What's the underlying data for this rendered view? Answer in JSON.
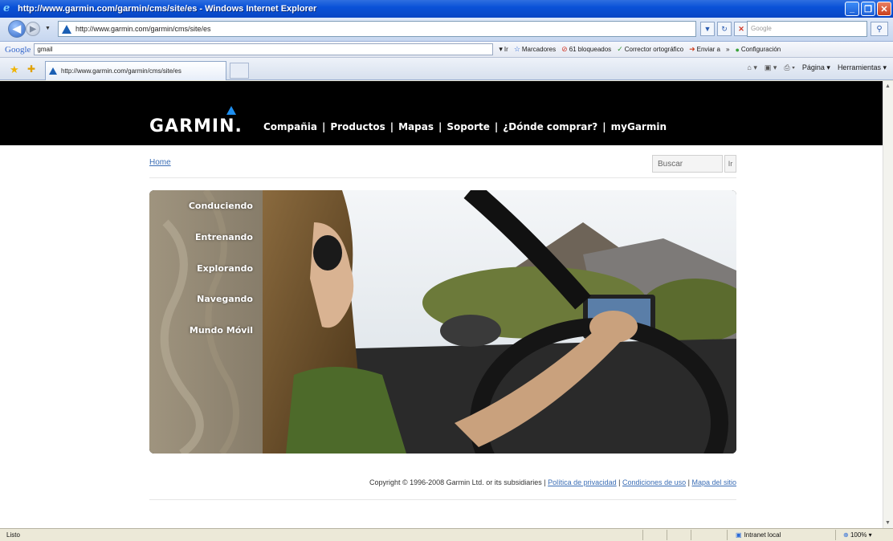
{
  "window": {
    "title": "http://www.garmin.com/garmin/cms/site/es - Windows Internet Explorer"
  },
  "address_bar": {
    "url": "http://www.garmin.com/garmin/cms/site/es",
    "search_placeholder": "Google"
  },
  "google_toolbar": {
    "logo": "Google",
    "search_value": "gmail",
    "go_label": "Ir",
    "bookmarks_label": "Marcadores",
    "blocked_label": "61 bloqueados",
    "spellcheck_label": "Corrector ortográfico",
    "send_label": "Enviar a",
    "more_label": "»",
    "settings_label": "Configuración"
  },
  "tabs": [
    {
      "label": "http://www.garmin.com/garmin/cms/site/es"
    }
  ],
  "command_bar": {
    "page_label": "Página",
    "tools_label": "Herramientas"
  },
  "page": {
    "logo": "GARMIN.",
    "nav": [
      "Compañia",
      "Productos",
      "Mapas",
      "Soporte",
      "¿Dónde comprar?",
      "myGarmin"
    ],
    "nav_separator": "|",
    "breadcrumb": "Home",
    "search_placeholder": "Buscar",
    "search_button": "Ir",
    "hero_menu": [
      "Conduciendo",
      "Entrenando",
      "Explorando",
      "Navegando",
      "Mundo Móvil"
    ],
    "footer": {
      "copyright": "Copyright © 1996-2008 Garmin Ltd. or its subsidiaries",
      "separator": "|",
      "links": [
        "Política de privacidad",
        "Condiciones de uso",
        "Mapa del sitio"
      ]
    }
  },
  "status_bar": {
    "status": "Listo",
    "zone": "Intranet local",
    "zoom": "100%"
  },
  "colors": {
    "header_bg": "#000000",
    "link": "#3a6db5",
    "logo_triangle": "#1e8ff0"
  }
}
